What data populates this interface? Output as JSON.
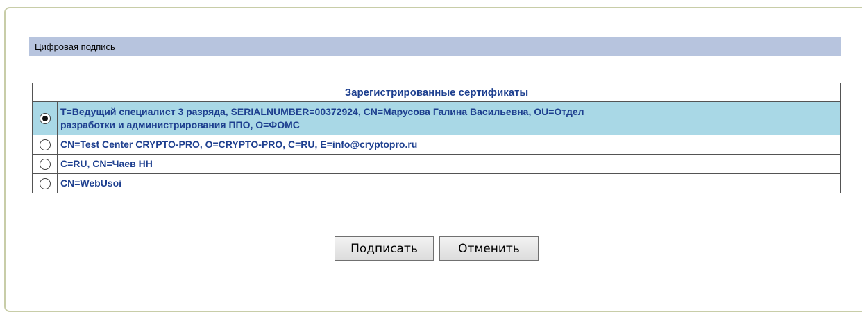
{
  "section": {
    "title": "Цифровая подпись"
  },
  "certificates": {
    "header": "Зарегистрированные сертификаты",
    "items": [
      {
        "line1": "T=Ведущий специалист 3 разряда, SERIALNUMBER=00372924, CN=Марусова Галина Васильевна, OU=Отдел",
        "line2": "разработки и администрирования ППО, O=ФОМС",
        "selected": true
      },
      {
        "line1": "CN=Test Center CRYPTO-PRO, O=CRYPTO-PRO, C=RU, E=info@cryptopro.ru",
        "selected": false
      },
      {
        "line1": "C=RU, CN=Чаев НН",
        "selected": false
      },
      {
        "line1": "CN=WebUsoi",
        "selected": false
      }
    ]
  },
  "actions": {
    "sign_label": "Подписать",
    "cancel_label": "Отменить"
  },
  "colors": {
    "header_bar": "#b7c4de",
    "selected_row": "#a9d8e6",
    "cert_text": "#1d3f8f",
    "panel_border": "#c8cda8"
  }
}
